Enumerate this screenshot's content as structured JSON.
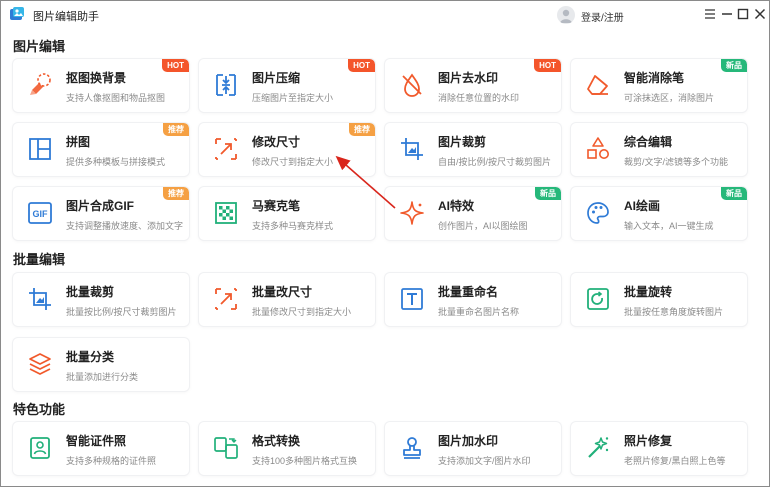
{
  "app": {
    "title": "图片编辑助手",
    "login_label": "登录/注册"
  },
  "sections": {
    "edit": "图片编辑",
    "batch": "批量编辑",
    "special": "特色功能"
  },
  "edit_cards": [
    {
      "name": "抠图换背景",
      "desc": "支持人像抠图和物品抠图",
      "badge": "HOT",
      "icon": "cutout-icon"
    },
    {
      "name": "图片压缩",
      "desc": "压缩图片至指定大小",
      "badge": "HOT",
      "icon": "compress-icon"
    },
    {
      "name": "图片去水印",
      "desc": "消除任意位置的水印",
      "badge": "HOT",
      "icon": "remove-watermark-icon"
    },
    {
      "name": "智能消除笔",
      "desc": "可涂抹选区，消除图片",
      "badge": "新品",
      "icon": "eraser-icon"
    },
    {
      "name": "拼图",
      "desc": "提供多种模板与拼接模式",
      "badge": "推荐",
      "icon": "collage-icon"
    },
    {
      "name": "修改尺寸",
      "desc": "修改尺寸到指定大小",
      "badge": "推荐",
      "icon": "resize-icon"
    },
    {
      "name": "图片裁剪",
      "desc": "自由/按比例/按尺寸裁剪图片",
      "badge": "",
      "icon": "crop-icon"
    },
    {
      "name": "综合编辑",
      "desc": "裁剪/文字/滤镜等多个功能",
      "badge": "",
      "icon": "shapes-icon"
    },
    {
      "name": "图片合成GIF",
      "desc": "支持调整播放速度、添加文字",
      "badge": "推荐",
      "icon": "gif-icon"
    },
    {
      "name": "马赛克笔",
      "desc": "支持多种马赛克样式",
      "badge": "",
      "icon": "mosaic-icon"
    },
    {
      "name": "AI特效",
      "desc": "创作图片，AI以图绘图",
      "badge": "新品",
      "icon": "sparkle-icon"
    },
    {
      "name": "AI绘画",
      "desc": "输入文本，AI一键生成",
      "badge": "新品",
      "icon": "palette-icon"
    }
  ],
  "batch_cards": [
    {
      "name": "批量裁剪",
      "desc": "批量按比例/按尺寸裁剪图片",
      "badge": "",
      "icon": "batch-crop-icon"
    },
    {
      "name": "批量改尺寸",
      "desc": "批量修改尺寸到指定大小",
      "badge": "",
      "icon": "batch-resize-icon"
    },
    {
      "name": "批量重命名",
      "desc": "批量重命名图片名称",
      "badge": "",
      "icon": "rename-icon"
    },
    {
      "name": "批量旋转",
      "desc": "批量按任意角度旋转图片",
      "badge": "",
      "icon": "rotate-icon"
    },
    {
      "name": "批量分类",
      "desc": "批量添加进行分类",
      "badge": "",
      "icon": "layers-icon"
    }
  ],
  "special_cards": [
    {
      "name": "智能证件照",
      "desc": "支持多种规格的证件照",
      "badge": "",
      "icon": "id-photo-icon"
    },
    {
      "name": "格式转换",
      "desc": "支持100多种图片格式互换",
      "badge": "",
      "icon": "convert-icon"
    },
    {
      "name": "图片加水印",
      "desc": "支持添加文字/图片水印",
      "badge": "",
      "icon": "stamp-icon"
    },
    {
      "name": "照片修复",
      "desc": "老照片修复/黑白照上色等",
      "badge": "",
      "icon": "magic-wand-icon"
    }
  ],
  "colors": {
    "orange": "#f15a2c",
    "blue": "#2f7bd6",
    "green": "#21b07a",
    "hot": "#f4552b",
    "recommend": "#f5a043",
    "new": "#26b87a",
    "annotation": "#d9261c"
  }
}
